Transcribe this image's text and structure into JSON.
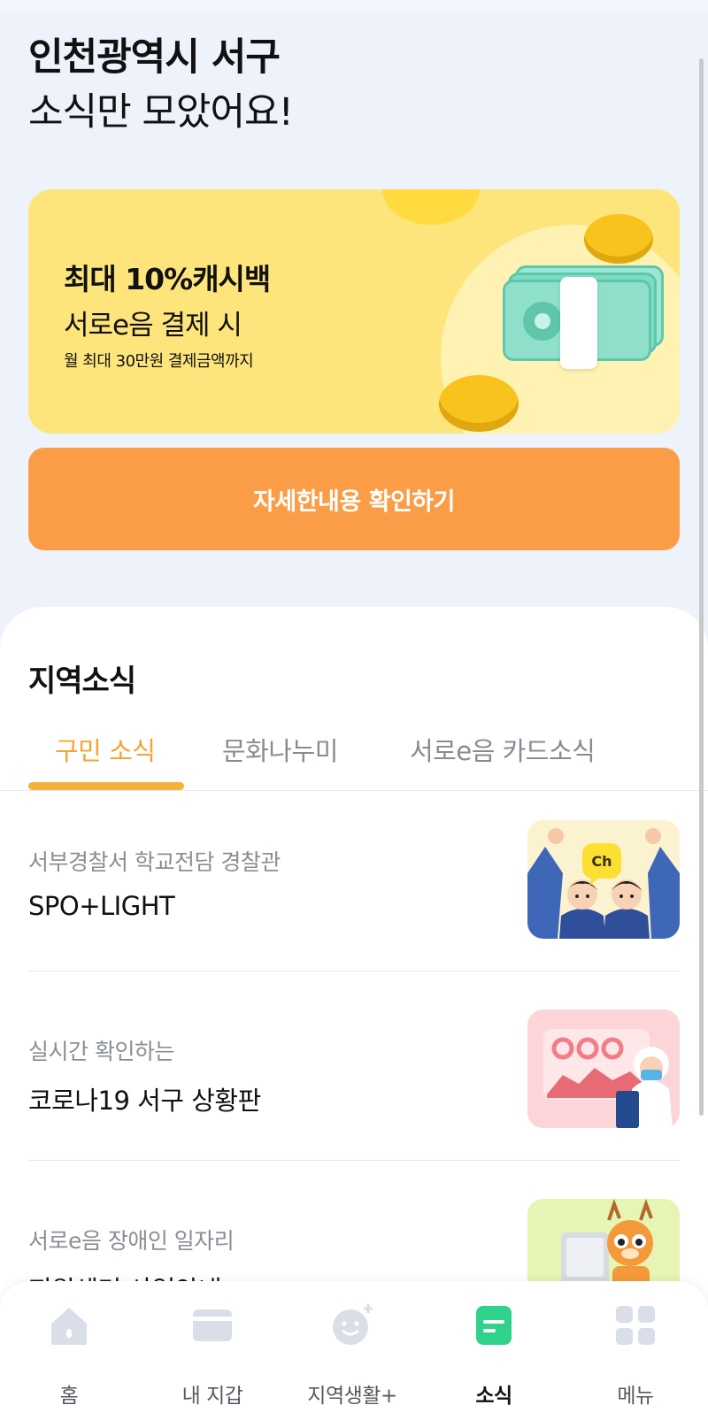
{
  "hero": {
    "title_line1": "인천광역시 서구",
    "title_line2": "소식만 모았어요!"
  },
  "banner": {
    "title": "최대 10%캐시백",
    "subtitle": "서로e음 결제 시",
    "note": "월 최대 30만원 결제금액까지",
    "bg_color": "#fde57c"
  },
  "cta": {
    "label": "자세한내용 확인하기",
    "color": "#fb9c46"
  },
  "section": {
    "title": "지역소식",
    "tabs": [
      {
        "label": "구민 소식",
        "active": true
      },
      {
        "label": "문화나누미",
        "active": false
      },
      {
        "label": "서로e음 카드소식",
        "active": false
      }
    ],
    "accent": "#f4a531"
  },
  "news": [
    {
      "sub": "서부경찰서 학교전담 경찰관",
      "title": "SPO+LIGHT",
      "thumb_icon": "police-officers-illustration",
      "badge": "Ch"
    },
    {
      "sub": "실시간 확인하는",
      "title": "코로나19 서구 상황판",
      "thumb_icon": "covid-dashboard-illustration"
    },
    {
      "sub": "서로e음 장애인 일자리",
      "title": "지원센터 사업안내",
      "thumb_icon": "mascot-at-computer-illustration"
    }
  ],
  "bottom_nav": [
    {
      "label": "홈",
      "icon": "home-icon",
      "active": false
    },
    {
      "label": "내 지갑",
      "icon": "wallet-icon",
      "active": false
    },
    {
      "label": "지역생활+",
      "icon": "local-life-icon",
      "active": false
    },
    {
      "label": "소식",
      "icon": "news-icon",
      "active": true,
      "active_color": "#2fd28a"
    },
    {
      "label": "메뉴",
      "icon": "menu-grid-icon",
      "active": false
    }
  ]
}
